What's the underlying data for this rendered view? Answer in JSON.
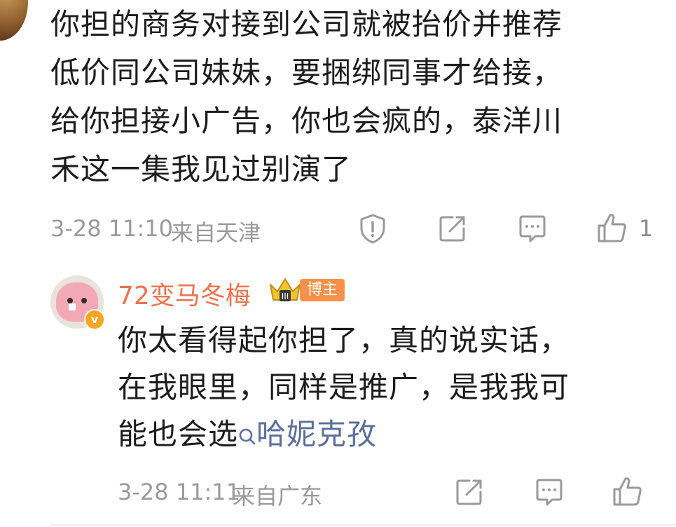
{
  "comment": {
    "lines": [
      "你担的商务对接到公司就被抬价并推荐",
      "低价同公司妹妹，要捆绑同事才给接，",
      "给你担接小广告，你也会疯的，泰洋川",
      "禾这一集我见过别演了"
    ],
    "time": "3-28 11:10",
    "location": "来自天津",
    "like_count": "1"
  },
  "reply": {
    "author": "72变马冬梅",
    "badge_label": "博主",
    "verified_mark": "v",
    "lines": [
      "你太看得起你担了，真的说实话，",
      "在我眼里，同样是推广，是我我可",
      "能也会选"
    ],
    "search_keyword": "哈妮克孜",
    "time": "3-28 11:11",
    "location": "来自广东"
  },
  "colors": {
    "username": "#eb7350",
    "link": "#5b6f9a",
    "meta": "#9a9a9a"
  },
  "icons": [
    "report-icon",
    "share-icon",
    "comment-icon",
    "like-icon",
    "search-icon"
  ]
}
